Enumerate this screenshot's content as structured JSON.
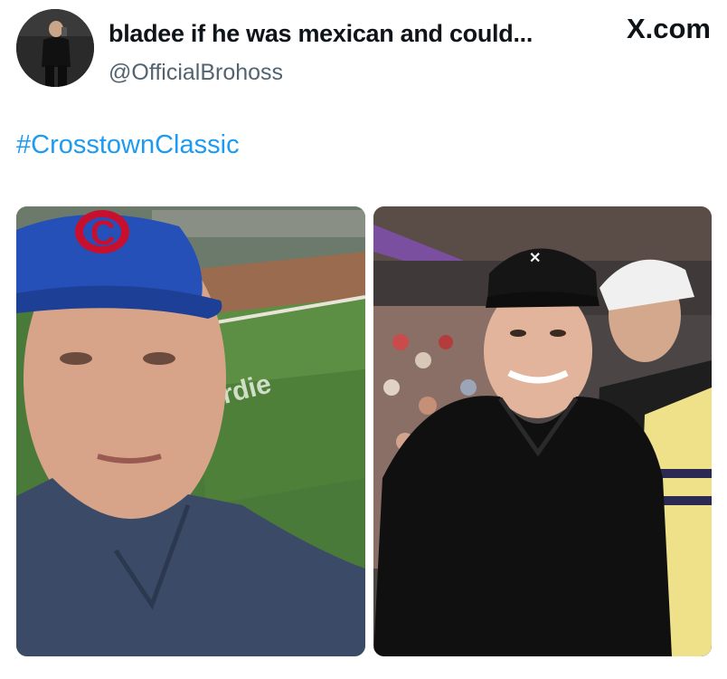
{
  "post": {
    "display_name": "bladee if he was mexican and could...",
    "handle": "@OfficialBrohoss",
    "source_brand": "X.com",
    "hashtag": "#CrosstownClassic"
  },
  "media": {
    "left_photo": {
      "stadium_sign_text": "ardie",
      "cap_letter": "C"
    },
    "right_photo": {}
  },
  "colors": {
    "hashtag": "#1d9bf0",
    "handle": "#536471",
    "text": "#0f1419"
  },
  "icons": {
    "brand_logo": "x-logo-icon"
  }
}
